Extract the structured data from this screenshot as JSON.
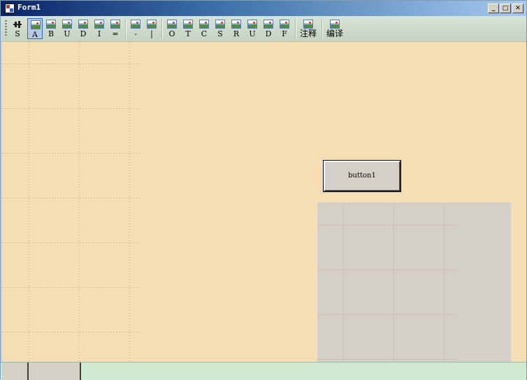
{
  "window": {
    "title": "Form1",
    "controls": {
      "minimize": "_",
      "maximize": "□",
      "close": "✕"
    }
  },
  "toolbar": {
    "buttons": [
      {
        "id": "s",
        "label": "S",
        "icon": "s-tool-icon",
        "active": false
      },
      {
        "id": "a",
        "label": "A",
        "icon": "image-icon",
        "active": true
      },
      {
        "id": "b",
        "label": "B",
        "icon": "image-icon"
      },
      {
        "id": "u",
        "label": "U",
        "icon": "image-icon"
      },
      {
        "id": "d",
        "label": "D",
        "icon": "image-icon"
      },
      {
        "id": "i",
        "label": "I",
        "icon": "image-icon"
      },
      {
        "id": "eq",
        "label": "=",
        "icon": "image-icon"
      },
      {
        "id": "minus",
        "label": "-",
        "icon": "image-icon"
      },
      {
        "id": "pipe",
        "label": "|",
        "icon": "image-icon"
      },
      {
        "id": "o",
        "label": "O",
        "icon": "image-icon"
      },
      {
        "id": "t",
        "label": "T",
        "icon": "image-icon"
      },
      {
        "id": "c",
        "label": "C",
        "icon": "image-icon"
      },
      {
        "id": "s2",
        "label": "S",
        "icon": "image-icon"
      },
      {
        "id": "r",
        "label": "R",
        "icon": "image-icon"
      },
      {
        "id": "u2",
        "label": "U",
        "icon": "image-icon"
      },
      {
        "id": "d2",
        "label": "D",
        "icon": "image-icon"
      },
      {
        "id": "f",
        "label": "F",
        "icon": "image-icon"
      },
      {
        "id": "comment",
        "label": "注释",
        "icon": "image-icon"
      },
      {
        "id": "compile",
        "label": "编译",
        "icon": "image-icon"
      }
    ]
  },
  "client": {
    "background": "#f5deb3",
    "button1_label": "button1",
    "panel_color": "#d4d0c8"
  },
  "status": {
    "background": "#cfe8d0"
  }
}
